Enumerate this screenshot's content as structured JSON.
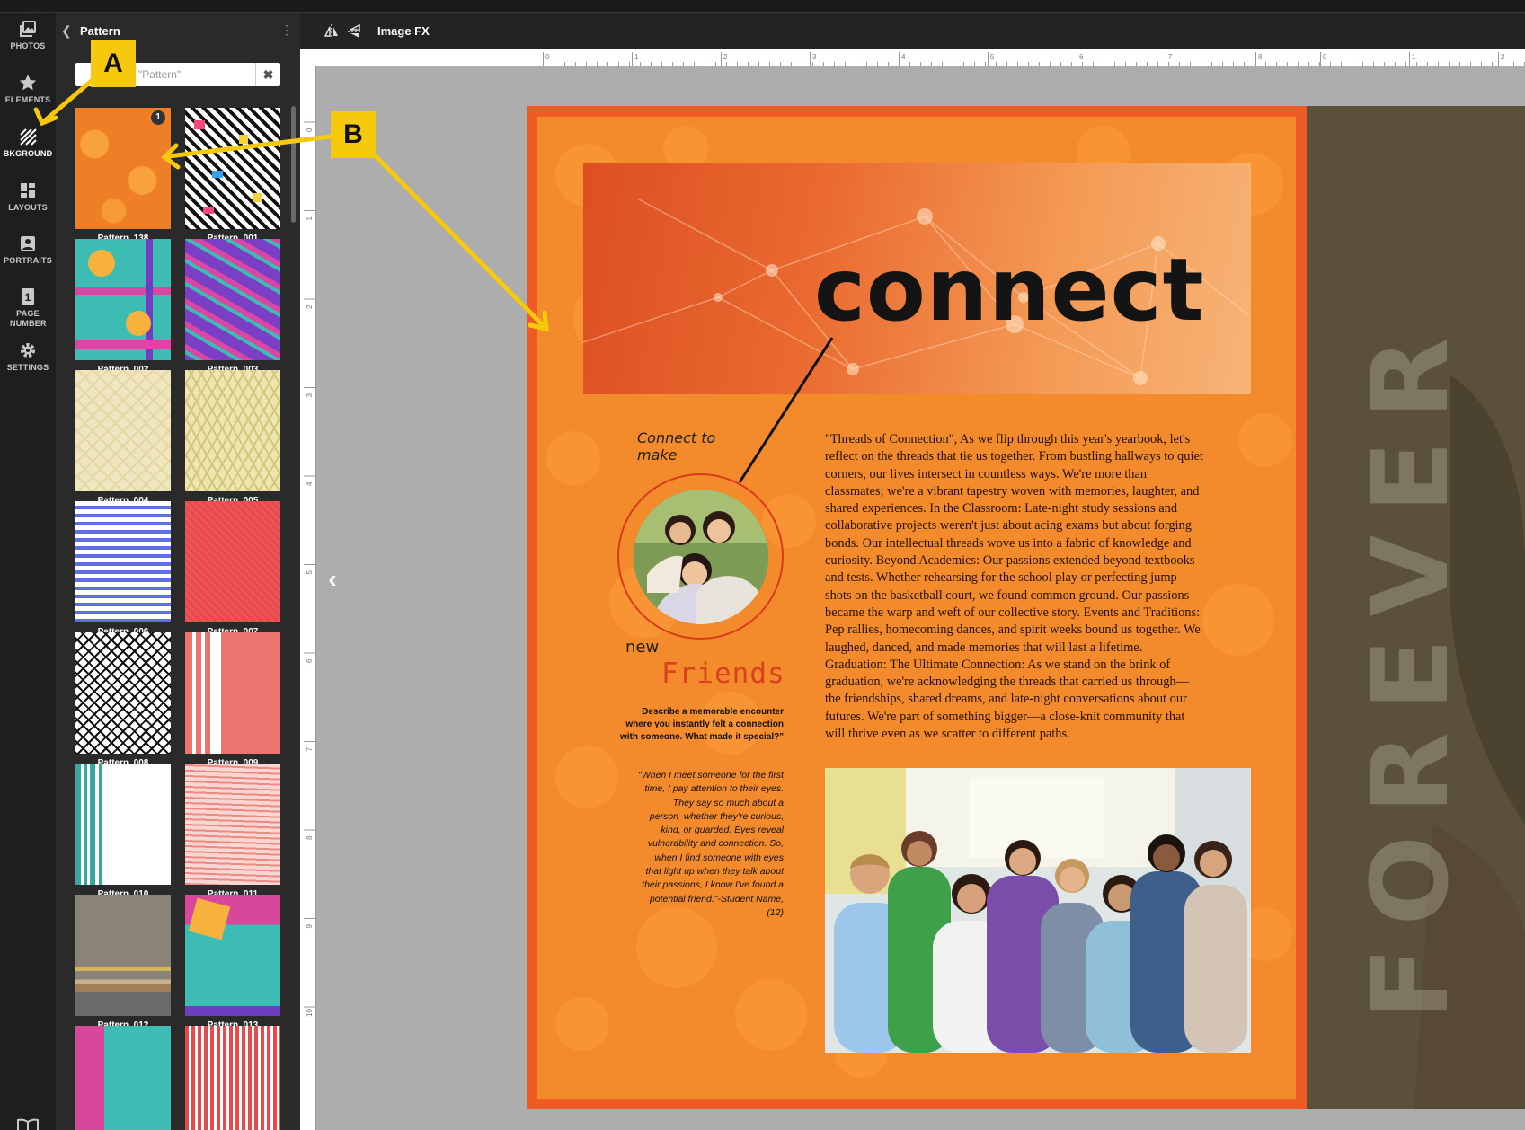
{
  "left_rail": {
    "items": [
      {
        "label": "PHOTOS",
        "icon": "photos-icon"
      },
      {
        "label": "ELEMENTS",
        "icon": "star-icon"
      },
      {
        "label": "BKGROUND",
        "icon": "background-hatch-icon",
        "active": true
      },
      {
        "label": "LAYOUTS",
        "icon": "layouts-grid-icon"
      },
      {
        "label": "PORTRAITS",
        "icon": "portrait-icon"
      },
      {
        "label": "PAGE NUMBER",
        "icon": "page-number-icon",
        "badge": "1"
      },
      {
        "label": "SETTINGS",
        "icon": "gear-icon"
      }
    ]
  },
  "panel": {
    "title": "Pattern",
    "search_value": "\"Pattern\"",
    "clear_symbol": "✖",
    "patterns": [
      {
        "label": "Pattern_138",
        "badge": "1"
      },
      {
        "label": "Pattern_001"
      },
      {
        "label": "Pattern_002"
      },
      {
        "label": "Pattern_003"
      },
      {
        "label": "Pattern_004"
      },
      {
        "label": "Pattern_005"
      },
      {
        "label": "Pattern_006"
      },
      {
        "label": "Pattern_007"
      },
      {
        "label": "Pattern_008"
      },
      {
        "label": "Pattern_009"
      },
      {
        "label": "Pattern_010"
      },
      {
        "label": "Pattern_011"
      },
      {
        "label": "Pattern_012"
      },
      {
        "label": "Pattern_013"
      }
    ]
  },
  "toolbar": {
    "image_fx_label": "Image FX"
  },
  "rulers": {
    "top": [
      "0",
      "1",
      "2",
      "3",
      "4",
      "5",
      "6",
      "7",
      "8",
      "0",
      "1",
      "2"
    ],
    "left": [
      "0",
      "1",
      "2",
      "3",
      "4",
      "5",
      "6",
      "7",
      "8",
      "9",
      "10"
    ]
  },
  "page": {
    "headline": "connect",
    "connect_to_make": "Connect to make",
    "new_word": "new",
    "friends_word": "Friends",
    "prompt": "Describe a memorable encounter where you instantly felt a connection with someone. What made it special?\"",
    "quote": "\"When I meet someone for the first time, I pay attention to their eyes. They say so much about a person–whether they're curious, kind, or guarded. Eyes reveal vulnerability and connection. So, when I find someone with eyes that light up when they talk about their passions, I know I've found a potential friend.\"-Student Name,(12)",
    "body": "\"Threads of Connection\", As we flip through this year's yearbook, let's reflect on the threads that tie us together. From bustling hallways to quiet corners, our lives intersect in countless ways. We're more than classmates; we're a vibrant tapestry woven with memories, laughter, and shared experiences. In the Classroom: Late-night study sessions and collaborative projects weren't just about acing exams but about forging bonds. Our intellectual threads wove us into a fabric of knowledge and curiosity. Beyond Academics: Our passions extended beyond textbooks and tests. Whether rehearsing for the school play or perfecting jump shots on the basketball court, we found common ground. Our passions became the warp and weft of our collective story. Events and Traditions: Pep rallies, homecoming dances, and spirit weeks bound us together. We laughed, danced, and made memories that will last a lifetime. Graduation: The Ultimate Connection: As we stand on the brink of graduation, we're acknowledging the threads that carried us through—the friendships, shared dreams, and late-night conversations about our futures. We're part of something bigger—a close-knit community that will thrive even as we scatter to different paths.",
    "facing_page_word": "FOREVER"
  },
  "annotations": {
    "a": "A",
    "b": "B"
  },
  "colors": {
    "accent_yellow": "#f6c90d",
    "page_orange": "#f38a2c",
    "page_border": "#ee5b25",
    "friends_red": "#d8421c"
  }
}
